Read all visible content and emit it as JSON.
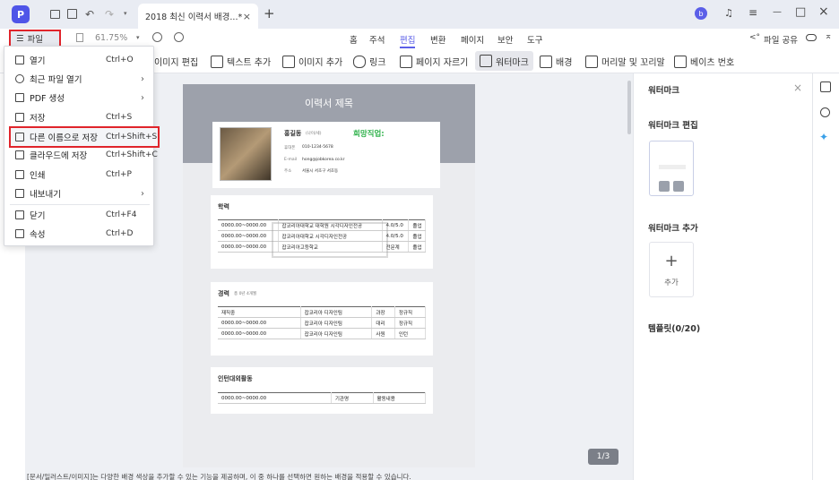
{
  "titlebar": {
    "app_logo": "P",
    "tab_title": "2018 최신 이력서 배경...*",
    "tab_close": "×",
    "new_tab": "+",
    "minimize": "—",
    "maximize": "□",
    "close": "×",
    "undo_dropdown": "▾"
  },
  "nav": {
    "file_label": "파일",
    "zoom": "61.75%",
    "zoom_caret": "▾",
    "tabs": [
      "홈",
      "주석",
      "편집",
      "변환",
      "페이지",
      "보안",
      "도구"
    ],
    "active_tab": "편집",
    "share_label": "파일 공유"
  },
  "toolbar": {
    "items": [
      "이미지 편집",
      "텍스트 추가",
      "이미지 추가",
      "링크",
      "페이지 자르기",
      "워터마크",
      "배경",
      "머리말 및 꼬리말",
      "베이츠 번호"
    ]
  },
  "file_menu": {
    "items": [
      {
        "label": "열기",
        "shortcut": "Ctrl+O",
        "arrow": ""
      },
      {
        "label": "최근 파일 열기",
        "shortcut": "",
        "arrow": "›"
      },
      {
        "label": "PDF 생성",
        "shortcut": "",
        "arrow": "›"
      },
      {
        "label": "저장",
        "shortcut": "Ctrl+S",
        "arrow": ""
      },
      {
        "label": "다른 이름으로 저장",
        "shortcut": "Ctrl+Shift+S",
        "arrow": ""
      },
      {
        "label": "클라우드에 저장",
        "shortcut": "Ctrl+Shift+C",
        "arrow": ""
      },
      {
        "label": "인쇄",
        "shortcut": "Ctrl+P",
        "arrow": ""
      },
      {
        "label": "내보내기",
        "shortcut": "",
        "arrow": "›"
      },
      {
        "label": "닫기",
        "shortcut": "Ctrl+F4",
        "arrow": ""
      },
      {
        "label": "속성",
        "shortcut": "Ctrl+D",
        "arrow": ""
      }
    ]
  },
  "resume": {
    "title": "이력서 제목",
    "name": "홍길동",
    "name_note": "(나이/세)",
    "wish": "희망직업:",
    "phone_label": "휴대폰",
    "phone": "010-1234-5678",
    "email_label": "E-mail",
    "email": "hong@jobkorea.co.kr",
    "addr_label": "주소",
    "addr": "서울시 서초구 서초동",
    "edu_title": "학력",
    "edu_rows": [
      [
        "0000.00~0000.00",
        "잡코리아대학교 대학원 시각디자인전공",
        "4.0/5.0",
        "졸업"
      ],
      [
        "0000.00~0000.00",
        "잡코리아대학교 시각디자인전공",
        "4.0/5.0",
        "졸업"
      ],
      [
        "0000.00~0000.00",
        "잡코리아고등학교",
        "전문계",
        "졸업"
      ]
    ],
    "career_title": "경력",
    "career_note": "총 0년 4개월",
    "career_rows": [
      [
        "재직중",
        "잡코리아 디자인팀",
        "과장",
        "정규직"
      ],
      [
        "0000.00~0000.00",
        "잡코리아 디자인팀",
        "대리",
        "정규직"
      ],
      [
        "0000.00~0000.00",
        "잡코리아 디자인팀",
        "사원",
        "인턴"
      ]
    ],
    "intern_title": "인턴대외활동",
    "intern_rows": [
      [
        "0000.00~0000.00",
        "기관명",
        "활동내용"
      ]
    ]
  },
  "page_counter": "1/3",
  "right_panel": {
    "title": "워터마크",
    "close": "×",
    "edit_title": "워터마크 편집",
    "add_title": "워터마크 추가",
    "add_plus": "+",
    "add_label": "추가",
    "template_label": "템플릿(0/20)"
  },
  "bottom_text": "[문서/일러스트/이미지]는 다양한 배경 색상을 추가할 수 있는 기능을 제공하며, 이 중 하나를 선택하면 원하는 배경을 적용할 수 있습니다.",
  "colors": {
    "accent": "#5b5fe8",
    "highlight": "#e0242b",
    "wish": "#2fb24b",
    "pagehead": "#9da1ab"
  }
}
